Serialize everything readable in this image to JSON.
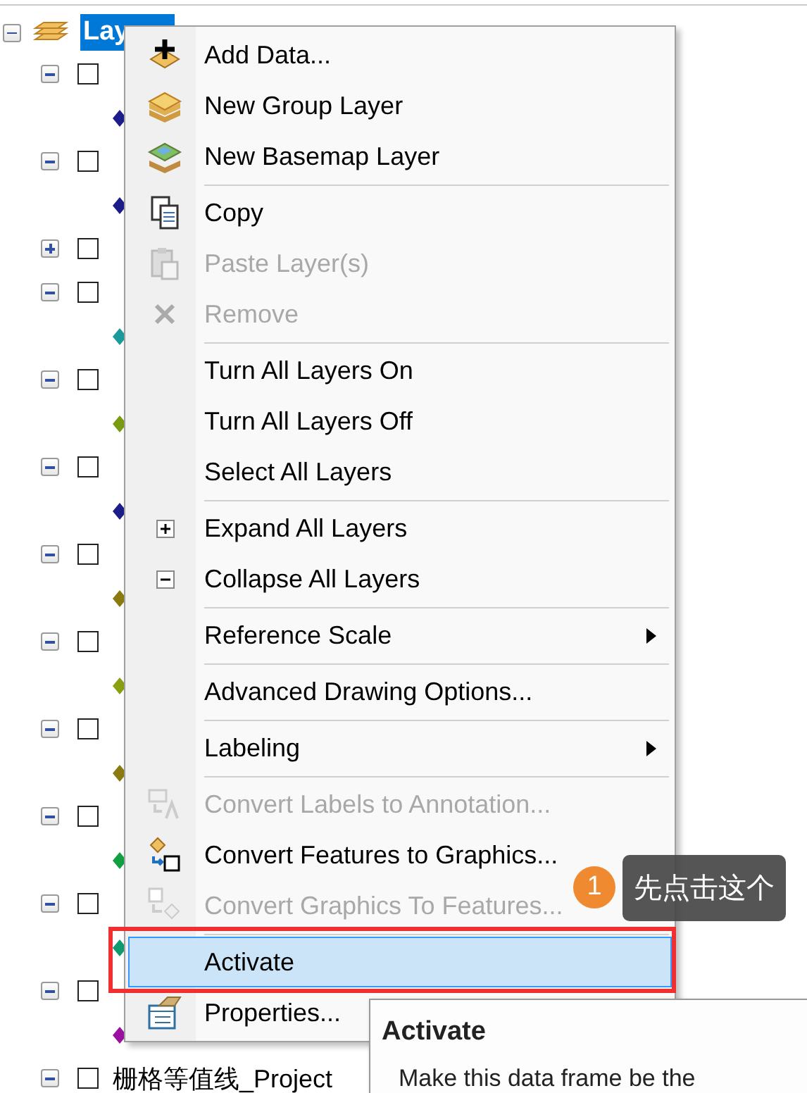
{
  "tree": {
    "root": {
      "label": "Lay",
      "expanded": true,
      "selected": true
    },
    "layers": [
      {
        "expanded": true,
        "checked": false,
        "legend": {
          "color": "#1c1c8a"
        }
      },
      {
        "expanded": true,
        "checked": false,
        "legend": {
          "color": "#1c1c8a"
        }
      },
      {
        "expanded": false,
        "checked": false
      },
      {
        "expanded": true,
        "checked": false,
        "legend": {
          "color": "#1a9a9a"
        }
      },
      {
        "expanded": true,
        "checked": false,
        "legend": {
          "color": "#7a9a10"
        }
      },
      {
        "expanded": true,
        "checked": false,
        "legend": {
          "color": "#1c1c8a"
        }
      },
      {
        "expanded": true,
        "checked": false,
        "legend": {
          "color": "#8a7a10"
        }
      },
      {
        "expanded": true,
        "checked": false,
        "legend": {
          "color": "#8aa010"
        }
      },
      {
        "expanded": true,
        "checked": false,
        "legend": {
          "color": "#8a7a10"
        }
      },
      {
        "expanded": true,
        "checked": false,
        "legend": {
          "color": "#10a040"
        }
      },
      {
        "expanded": true,
        "checked": false,
        "legend": {
          "color": "#109a70"
        }
      },
      {
        "expanded": true,
        "checked": false,
        "legend": {
          "color": "#9a10a0"
        }
      },
      {
        "expanded": true,
        "checked": false,
        "label": "栅格等值线_Project"
      }
    ]
  },
  "context_menu": {
    "entries": [
      {
        "kind": "item",
        "label": "Add Data...",
        "disabled": false,
        "selected": false
      },
      {
        "kind": "item",
        "label": "New Group Layer",
        "disabled": false,
        "selected": false
      },
      {
        "kind": "item",
        "label": "New Basemap Layer",
        "disabled": false,
        "selected": false
      },
      {
        "kind": "separator"
      },
      {
        "kind": "item",
        "label": "Copy",
        "disabled": false,
        "selected": false
      },
      {
        "kind": "item",
        "label": "Paste Layer(s)",
        "disabled": true,
        "selected": false
      },
      {
        "kind": "item",
        "label": "Remove",
        "disabled": true,
        "selected": false
      },
      {
        "kind": "separator"
      },
      {
        "kind": "item",
        "label": "Turn All Layers On",
        "disabled": false,
        "selected": false
      },
      {
        "kind": "item",
        "label": "Turn All Layers Off",
        "disabled": false,
        "selected": false
      },
      {
        "kind": "item",
        "label": "Select All Layers",
        "disabled": false,
        "selected": false
      },
      {
        "kind": "separator"
      },
      {
        "kind": "item",
        "label": "Expand All Layers",
        "disabled": false,
        "selected": false
      },
      {
        "kind": "item",
        "label": "Collapse All Layers",
        "disabled": false,
        "selected": false
      },
      {
        "kind": "separator"
      },
      {
        "kind": "item",
        "label": "Reference Scale",
        "disabled": false,
        "selected": false,
        "submenu": true
      },
      {
        "kind": "separator"
      },
      {
        "kind": "item",
        "label": "Advanced Drawing Options...",
        "disabled": false,
        "selected": false
      },
      {
        "kind": "separator"
      },
      {
        "kind": "item",
        "label": "Labeling",
        "disabled": false,
        "selected": false,
        "submenu": true
      },
      {
        "kind": "separator"
      },
      {
        "kind": "item",
        "label": "Convert Labels to Annotation...",
        "disabled": true,
        "selected": false
      },
      {
        "kind": "item",
        "label": "Convert Features to Graphics...",
        "disabled": false,
        "selected": false
      },
      {
        "kind": "item",
        "label": "Convert Graphics To Features...",
        "disabled": true,
        "selected": false
      },
      {
        "kind": "separator"
      },
      {
        "kind": "item",
        "label": "Activate",
        "disabled": false,
        "selected": true
      },
      {
        "kind": "item",
        "label": "Properties...",
        "disabled": false,
        "selected": false
      }
    ]
  },
  "annotation": {
    "badge": "1",
    "callout": "先点击这个"
  },
  "tooltip": {
    "title": "Activate",
    "text": "Make this data frame be the"
  }
}
